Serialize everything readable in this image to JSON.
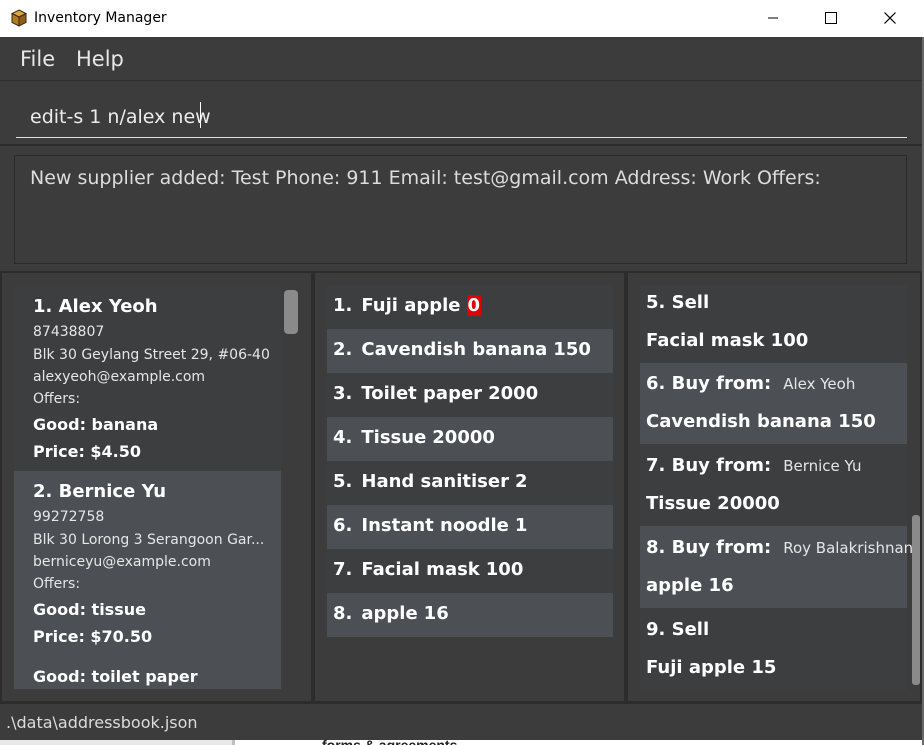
{
  "window": {
    "title": "Inventory Manager",
    "controls": {
      "minimize": "minimize-icon",
      "maximize": "maximize-icon",
      "close": "close-icon"
    }
  },
  "menu": {
    "file": "File",
    "help": "Help"
  },
  "command": {
    "value": "edit-s 1 n/alex new"
  },
  "result": {
    "text": "New supplier added: Test Phone: 911 Email: test@gmail.com Address: Work Offers:"
  },
  "suppliers": [
    {
      "title": "1.  Alex Yeoh",
      "phone": "87438807",
      "address": "Blk 30 Geylang Street 29, #06-40",
      "email": "alexyeoh@example.com",
      "offers_label": "Offers:",
      "offers": [
        {
          "good": "Good: banana",
          "price": "Price: $4.50"
        }
      ]
    },
    {
      "title": "2.  Bernice Yu",
      "phone": "99272758",
      "address": "Blk 30 Lorong 3 Serangoon Gar...",
      "email": "berniceyu@example.com",
      "offers_label": "Offers:",
      "offers": [
        {
          "good": "Good: tissue",
          "price": "Price: $70.50"
        },
        {
          "good": "Good: toilet paper",
          "price": ""
        }
      ]
    }
  ],
  "goods": [
    {
      "index": "1.",
      "name": "Fuji apple",
      "qty": "0",
      "alert": true
    },
    {
      "index": "2.",
      "name": "Cavendish banana",
      "qty": "150",
      "alert": false
    },
    {
      "index": "3.",
      "name": "Toilet paper",
      "qty": "2000",
      "alert": false
    },
    {
      "index": "4.",
      "name": "Tissue",
      "qty": "20000",
      "alert": false
    },
    {
      "index": "5.",
      "name": "Hand sanitiser",
      "qty": "2",
      "alert": false
    },
    {
      "index": "6.",
      "name": "Instant noodle",
      "qty": "1",
      "alert": false
    },
    {
      "index": "7.",
      "name": "Facial mask",
      "qty": "100",
      "alert": false
    },
    {
      "index": "8.",
      "name": "apple",
      "qty": "16",
      "alert": false
    }
  ],
  "transactions": [
    {
      "head": "5.  Sell",
      "party": "",
      "item": "Facial mask 100"
    },
    {
      "head": "6.  Buy from:",
      "party": "Alex Yeoh",
      "item": "Cavendish banana 150"
    },
    {
      "head": "7.  Buy from:",
      "party": "Bernice Yu",
      "item": "Tissue 20000"
    },
    {
      "head": "8.  Buy from:",
      "party": "Roy Balakrishnan",
      "item": "apple 16"
    },
    {
      "head": "9.  Sell",
      "party": "",
      "item": "Fuji apple 15"
    }
  ],
  "status": {
    "path": ".\\data\\addressbook.json"
  },
  "background_window": {
    "text": "forms & agreements"
  },
  "colors": {
    "alert": "#e00000",
    "panel_bg": "#3c3c3c",
    "card_alt": "#4c5054"
  }
}
